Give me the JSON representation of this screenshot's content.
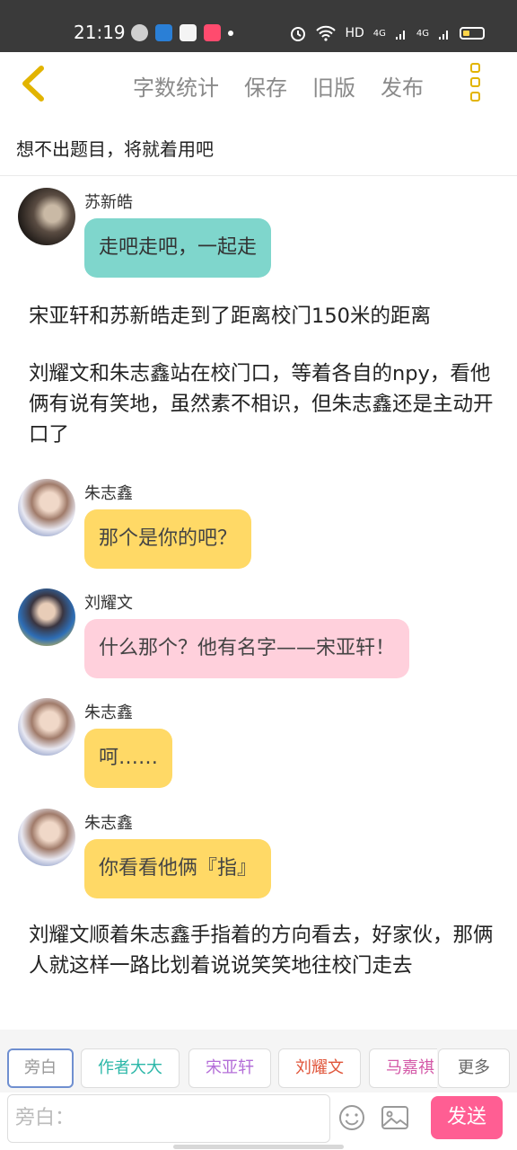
{
  "status_bar": {
    "time": "21:19",
    "network": "HD",
    "signal_1": "4G",
    "signal_2": "4G"
  },
  "toolbar": {
    "items": [
      "字数统计",
      "保存",
      "旧版",
      "发布"
    ]
  },
  "title": "想不出题目，将就着用吧",
  "messages": [
    {
      "speaker": "苏新皓",
      "text": "走吧走吧，一起走",
      "bubble_color": "#7fd6cc"
    },
    {
      "narration": "宋亚轩和苏新皓走到了距离校门150米的距离"
    },
    {
      "narration": "刘耀文和朱志鑫站在校门口，等着各自的npy，看他俩有说有笑地，虽然素不相识，但朱志鑫还是主动开口了"
    },
    {
      "speaker": "朱志鑫",
      "text": "那个是你的吧？",
      "bubble_color": "#ffd966"
    },
    {
      "speaker": "刘耀文",
      "text": "什么那个？他有名字——宋亚轩！",
      "bubble_color": "#ffd0dc"
    },
    {
      "speaker": "朱志鑫",
      "text": "呵……",
      "bubble_color": "#ffd966"
    },
    {
      "speaker": "朱志鑫",
      "text": "你看看他俩『指』",
      "bubble_color": "#ffd966"
    },
    {
      "narration": "刘耀文顺着朱志鑫手指着的方向看去，好家伙，那俩人就这样一路比划着说说笑笑地往校门走去"
    }
  ],
  "characters": [
    {
      "label": "旁白",
      "color": "#999999"
    },
    {
      "label": "作者大大",
      "color": "#2bb7a8"
    },
    {
      "label": "宋亚轩",
      "color": "#b46fd8"
    },
    {
      "label": "刘耀文",
      "color": "#e0553a"
    },
    {
      "label": "马嘉祺",
      "color": "#d45aa8"
    },
    {
      "label": "更多",
      "color": "#666666"
    }
  ],
  "input": {
    "placeholder": "旁白：",
    "send_label": "发送"
  },
  "colors": {
    "accent_yellow": "#e2b400",
    "send_pink": "#ff5e93"
  }
}
